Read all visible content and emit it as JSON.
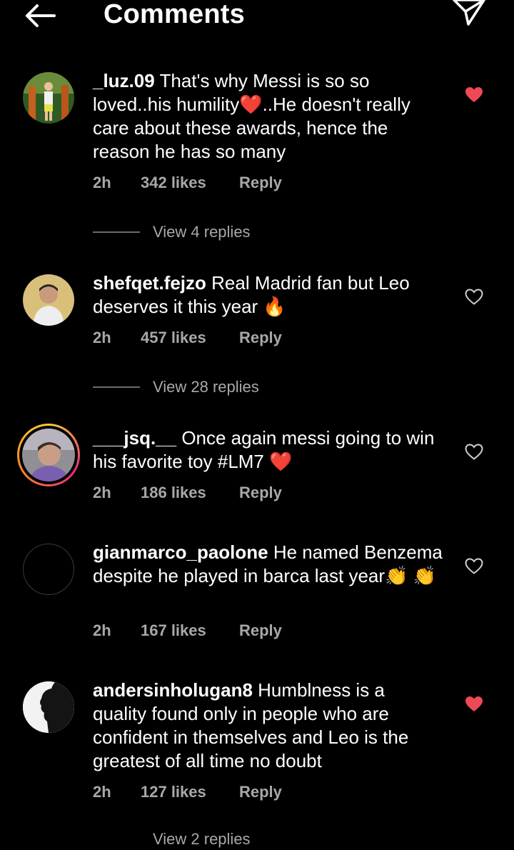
{
  "header": {
    "title": "Comments",
    "back_icon": "arrow-left-icon",
    "share_icon": "paper-plane-icon"
  },
  "comments": [
    {
      "username": "_luz.09",
      "text": " That's why Messi is so so loved..his humility❤️..He doesn't really care about these awards, hence the reason he has so many",
      "time": "2h",
      "likes": "342 likes",
      "reply": "Reply",
      "liked": true,
      "view_replies": "View 4 replies"
    },
    {
      "username": "shefqet.fejzo",
      "text": " Real Madrid fan but Leo deserves it this year 🔥",
      "time": "2h",
      "likes": "457 likes",
      "reply": "Reply",
      "liked": false,
      "view_replies": "View 28 replies"
    },
    {
      "username": "___jsq.__",
      "text": " Once again messi going to win his favorite toy #LM7 ❤️",
      "time": "2h",
      "likes": "186 likes",
      "reply": "Reply",
      "liked": false,
      "story_ring": true
    },
    {
      "username": "gianmarco_paolone",
      "text": " He named Benzema despite he played in barca last year👏 👏",
      "time": "2h",
      "likes": "167 likes",
      "reply": "Reply",
      "liked": false
    },
    {
      "username": "andersinholugan8",
      "text": " Humblness is a quality found only in people who are confident in themselves and Leo is the greatest of all time no doubt",
      "time": "2h",
      "likes": "127 likes",
      "reply": "Reply",
      "liked": true,
      "view_replies": "View 2 replies"
    }
  ],
  "colors": {
    "background": "#000000",
    "text": "#ffffff",
    "muted": "#a8a8a8",
    "like_red": "#ed4956"
  }
}
